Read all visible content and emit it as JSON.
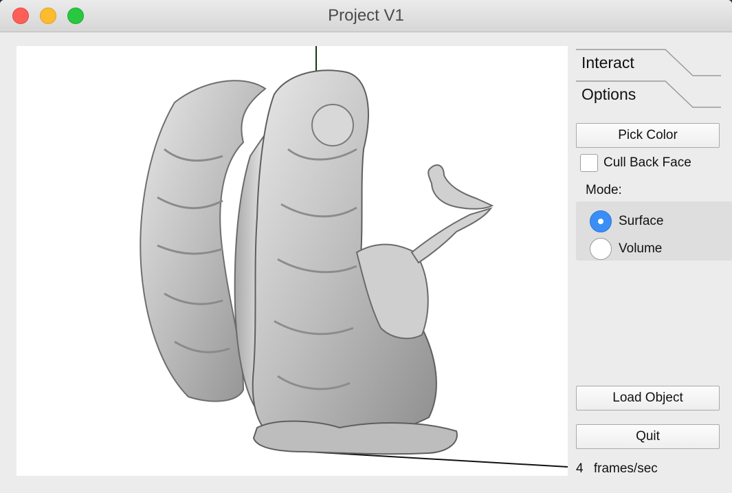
{
  "window": {
    "title": "Project V1"
  },
  "viewport": {
    "object": "angel-statue",
    "shading": "surface",
    "model_color": "#c8c8c8",
    "background": "#ffffff"
  },
  "panel": {
    "tabs": [
      {
        "label": "Interact"
      },
      {
        "label": "Options"
      }
    ],
    "pick_color_label": "Pick Color",
    "cull_back_face": {
      "label": "Cull Back Face",
      "checked": false
    },
    "mode": {
      "label": "Mode:",
      "options": [
        {
          "label": "Surface",
          "selected": true
        },
        {
          "label": "Volume",
          "selected": false
        }
      ]
    },
    "load_object_label": "Load Object",
    "quit_label": "Quit"
  },
  "status": {
    "fps_value": "4",
    "fps_unit": "frames/sec"
  },
  "colors": {
    "accent": "#3a8ef6",
    "close": "#fc5f57",
    "minimize": "#fdbc2e",
    "maximize": "#28c840"
  }
}
